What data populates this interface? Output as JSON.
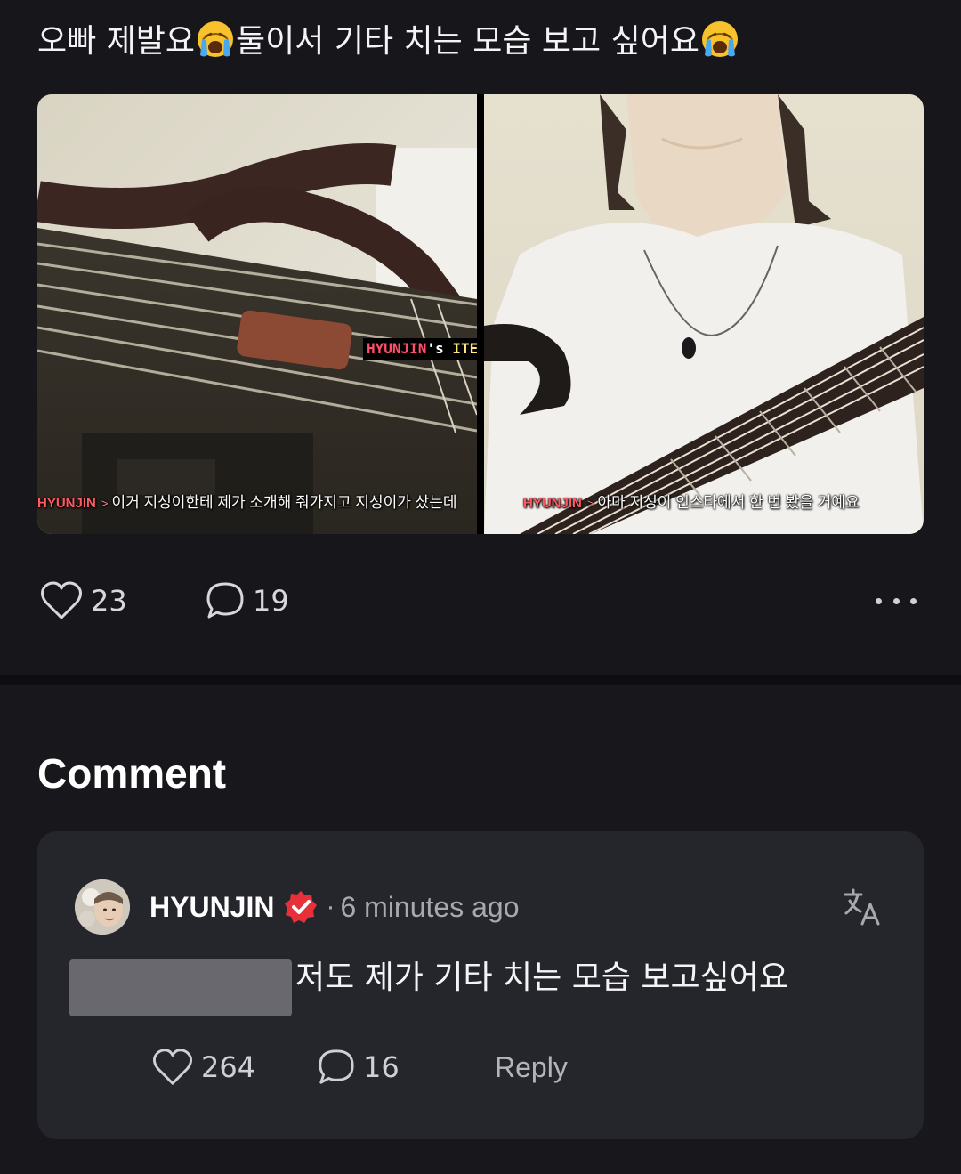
{
  "post": {
    "title_part1": "오빠 제발요",
    "title_part2": "둘이서 기타 치는 모습 보고 싶어요",
    "title_emoji": "loudly-crying-face",
    "images": [
      {
        "caption_speaker": "HYUNJIN",
        "caption_text": "이거 지성이한테 제가 소개해 줘가지고 지성이가 샀는데",
        "tag_part1": "HYUNJIN",
        "tag_part2": "'s",
        "tag_part3": "ITEM"
      },
      {
        "caption_speaker": "HYUNJIN",
        "caption_text": "아마 지성이 인스타에서 한 번 봤을 거예요"
      }
    ],
    "likes": "23",
    "comments_count": "19",
    "more_icon": "more-horizontal-icon"
  },
  "comments_section": {
    "heading": "Comment",
    "items": [
      {
        "author": "HYUNJIN",
        "verified": true,
        "separator": "·",
        "time": "6 minutes ago",
        "text": "저도 제가 기타 치는 모습 보고싶어요",
        "likes": "264",
        "replies": "16",
        "reply_label": "Reply"
      }
    ]
  },
  "colors": {
    "background": "#16161b",
    "card": "#25252c",
    "badge_red": "#e8303a",
    "text_primary": "#f4f4f6",
    "text_secondary": "#a8a8b0"
  }
}
